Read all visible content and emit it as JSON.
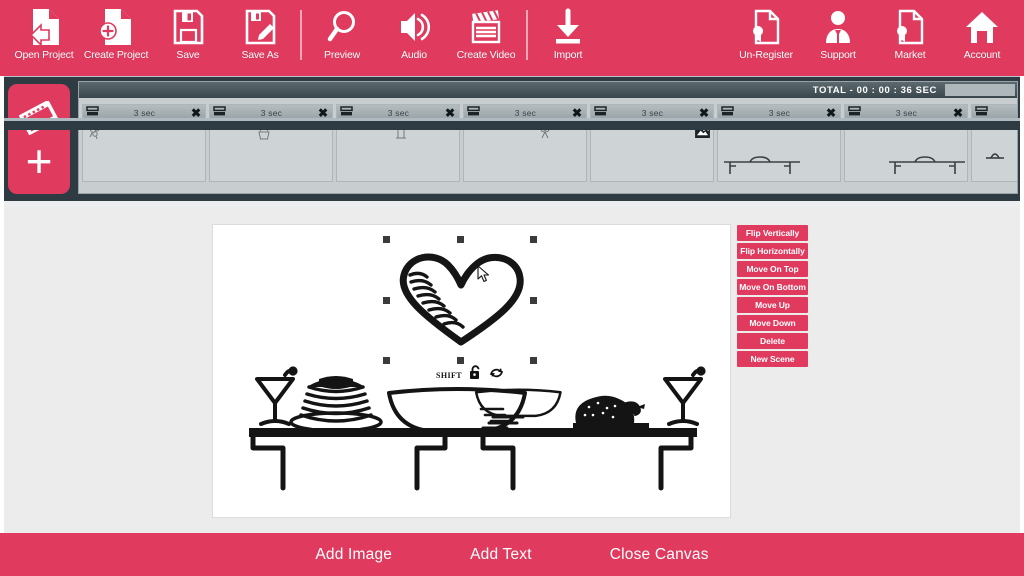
{
  "app": {
    "accent_color": "#e03a5e",
    "timeline_bg": "#2e3b42",
    "workarea_bg": "#ececec"
  },
  "toolbar": {
    "left_items": [
      {
        "label": "Open Project",
        "icon": "open-project-icon"
      },
      {
        "label": "Create Project",
        "icon": "create-project-icon"
      },
      {
        "label": "Save",
        "icon": "save-icon"
      },
      {
        "label": "Save As",
        "icon": "save-as-icon"
      },
      {
        "label": "Preview",
        "icon": "magnifier-icon"
      },
      {
        "label": "Audio",
        "icon": "speaker-icon"
      },
      {
        "label": "Create Video",
        "icon": "clapperboard-icon"
      },
      {
        "label": "Import",
        "icon": "download-icon"
      }
    ],
    "right_items": [
      {
        "label": "Un-Register",
        "icon": "certificate-icon"
      },
      {
        "label": "Support",
        "icon": "support-agent-icon"
      },
      {
        "label": "Market",
        "icon": "certificate-icon"
      },
      {
        "label": "Account",
        "icon": "home-icon"
      }
    ]
  },
  "timeline": {
    "add_scene_label": "",
    "add_scene_icon": "film-strip-plus-icon",
    "total_label": "TOTAL -  00 : 00 : 36 SEC",
    "clips": [
      {
        "duration": "3 sec",
        "close": "✖",
        "sketch": "flower-sketch",
        "has_image_badge": false
      },
      {
        "duration": "3 sec",
        "close": "✖",
        "sketch": "cupcake-sketch",
        "has_image_badge": false
      },
      {
        "duration": "3 sec",
        "close": "✖",
        "sketch": "candle-sketch",
        "has_image_badge": false
      },
      {
        "duration": "3 sec",
        "close": "✖",
        "sketch": "ribbon-sketch",
        "has_image_badge": false
      },
      {
        "duration": "3 sec",
        "close": "✖",
        "sketch": "",
        "has_image_badge": true
      },
      {
        "duration": "3 sec",
        "close": "✖",
        "sketch": "table-sketch",
        "has_image_badge": false
      },
      {
        "duration": "3 sec",
        "close": "✖",
        "sketch": "table-sketch",
        "has_image_badge": false
      },
      {
        "duration": "",
        "close": "",
        "sketch": "small-sketch",
        "has_image_badge": false
      }
    ]
  },
  "canvas": {
    "selection": {
      "shift_label": "SHIFT",
      "lock_icon": "unlock-icon",
      "rotate_icon": "rotate-icon"
    },
    "artwork": {
      "foreground": "heart-doodle",
      "background": "buffet-table-doodle",
      "items": [
        "martini-glass",
        "pancake-stack",
        "bowl",
        "bowl",
        "roast-turkey",
        "martini-glass"
      ]
    }
  },
  "actions": {
    "buttons": [
      "Flip Vertically",
      "Flip Horizontally",
      "Move On Top",
      "Move On Bottom",
      "Move Up",
      "Move Down",
      "Delete",
      "New Scene"
    ]
  },
  "bottombar": {
    "items": [
      "Add Image",
      "Add Text",
      "Close Canvas"
    ]
  }
}
